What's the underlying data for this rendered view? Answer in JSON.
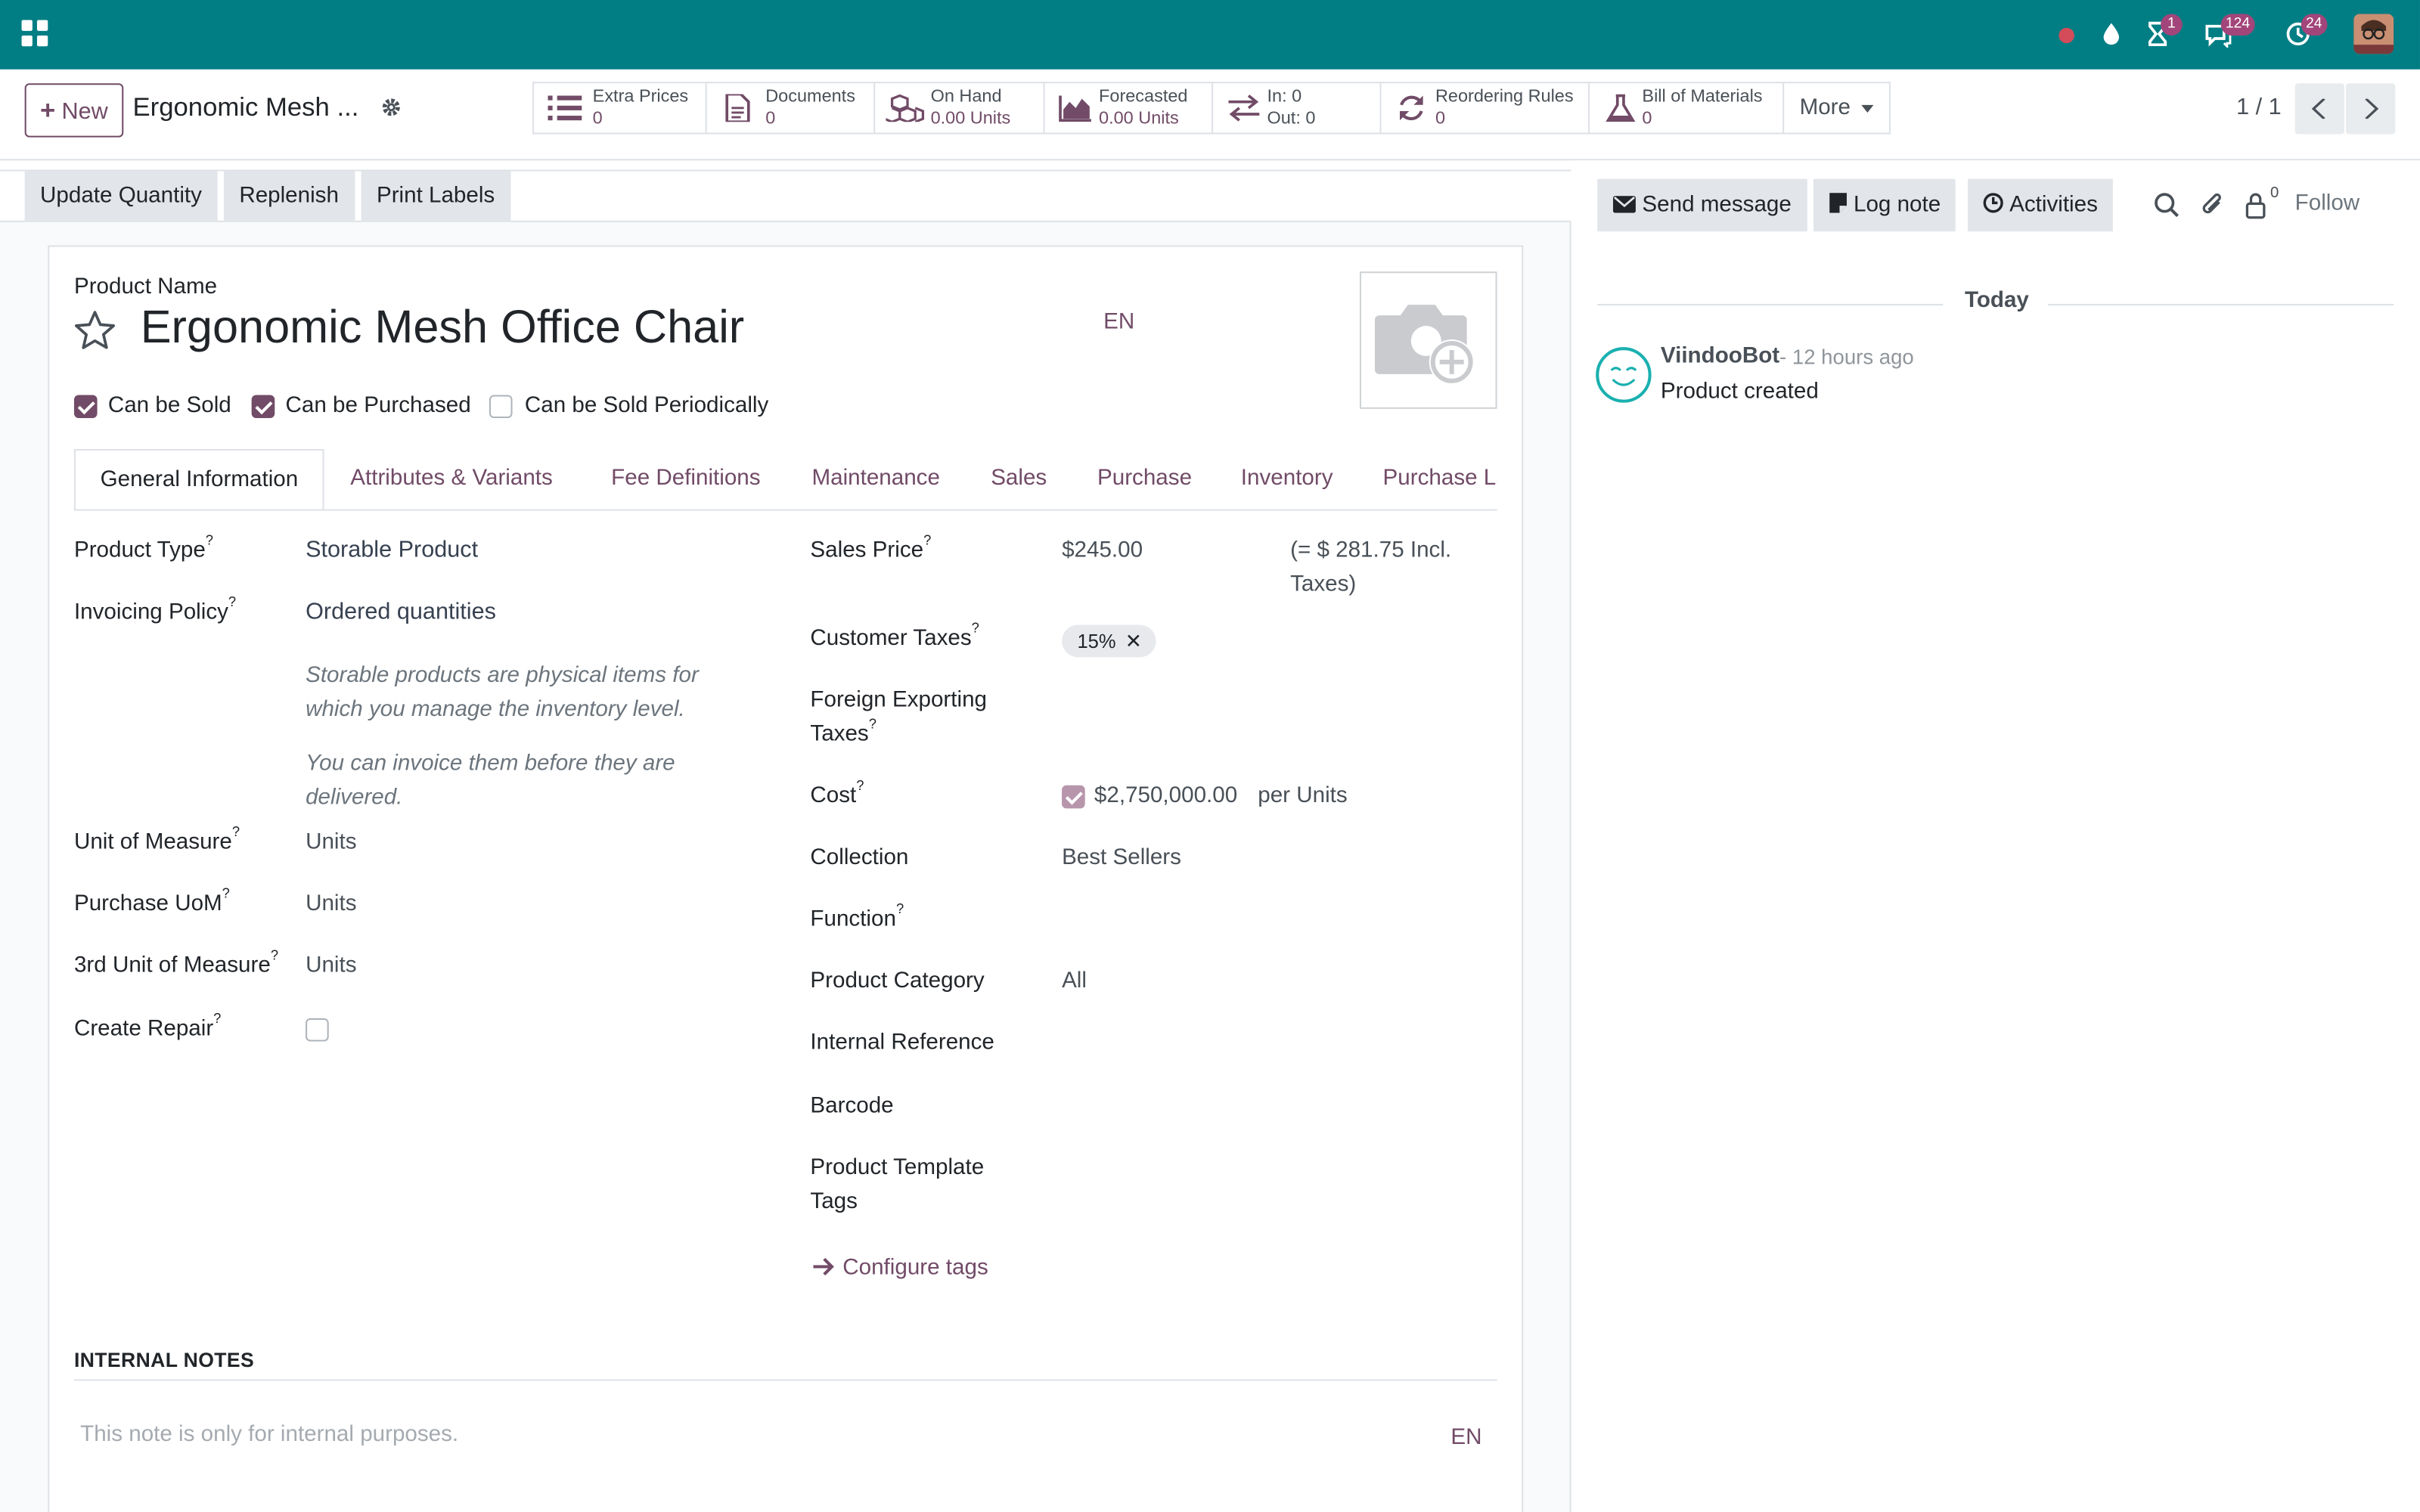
{
  "navbar": {
    "badges": {
      "activities": "1",
      "messages": "124",
      "timers": "24"
    },
    "colors": {
      "bar": "#017e84",
      "badge": "#a2457a",
      "record": "#d44c59"
    }
  },
  "control_panel": {
    "new_label": "New",
    "breadcrumb": "Ergonomic Mesh ...",
    "smart_buttons": [
      {
        "icon": "list-icon",
        "line1": "Extra Prices",
        "line2": "0"
      },
      {
        "icon": "document-icon",
        "line1": "Documents",
        "line2": "0"
      },
      {
        "icon": "cubes-icon",
        "line1": "On Hand",
        "line2": "0.00 Units"
      },
      {
        "icon": "area-chart-icon",
        "line1": "Forecasted",
        "line2": "0.00 Units"
      },
      {
        "icon": "exchange-icon",
        "line1": "In: 0",
        "line2": "Out: 0"
      },
      {
        "icon": "refresh-icon",
        "line1": "Reordering Rules",
        "line2": "0"
      },
      {
        "icon": "flask-icon",
        "line1": "Bill of Materials",
        "line2": "0"
      }
    ],
    "more_label": "More",
    "pager": "1 / 1"
  },
  "statusbar": {
    "update_qty": "Update Quantity",
    "replenish": "Replenish",
    "print_labels": "Print Labels"
  },
  "form": {
    "product_name_label": "Product Name",
    "product_name": "Ergonomic Mesh Office Chair",
    "lang": "EN",
    "checkboxes": {
      "can_be_sold": "Can be Sold",
      "can_be_purchased": "Can be Purchased",
      "can_be_sold_periodically": "Can be Sold Periodically"
    },
    "tabs": [
      "General Information",
      "Attributes & Variants",
      "Fee Definitions",
      "Maintenance",
      "Sales",
      "Purchase",
      "Inventory",
      "Purchase Lan"
    ],
    "left": {
      "product_type_label": "Product Type",
      "product_type": "Storable Product",
      "invoicing_policy_label": "Invoicing Policy",
      "invoicing_policy": "Ordered quantities",
      "note1": "Storable products are physical items for which you manage the inventory level.",
      "note2": "You can invoice them before they are delivered.",
      "uom_label": "Unit of Measure",
      "uom": "Units",
      "purchase_uom_label": "Purchase UoM",
      "purchase_uom": "Units",
      "third_uom_label": "3rd Unit of Measure",
      "third_uom": "Units",
      "create_repair_label": "Create Repair"
    },
    "right": {
      "sales_price_label": "Sales Price",
      "sales_price": "$245.00",
      "incl_taxes": "(= $ 281.75 Incl. Taxes)",
      "customer_taxes_label": "Customer Taxes",
      "customer_tax_tag": "15%",
      "foreign_taxes_label": "Foreign Exporting Taxes",
      "cost_label": "Cost",
      "cost": "$2,750,000.00",
      "cost_unit": "per Units",
      "collection_label": "Collection",
      "collection": "Best Sellers",
      "function_label": "Function",
      "category_label": "Product Category",
      "category": "All",
      "internal_ref_label": "Internal Reference",
      "barcode_label": "Barcode",
      "template_tags_label": "Product Template Tags",
      "configure_tags": "Configure tags"
    },
    "internal_notes_label": "INTERNAL NOTES",
    "internal_notes_placeholder": "This note is only for internal purposes."
  },
  "chatter": {
    "send_message": "Send message",
    "log_note": "Log note",
    "activities": "Activities",
    "followers_count": "0",
    "follow": "Follow",
    "today": "Today",
    "messages": [
      {
        "author": "ViindooBot",
        "time": "- 12 hours ago",
        "body": "Product created"
      }
    ]
  }
}
